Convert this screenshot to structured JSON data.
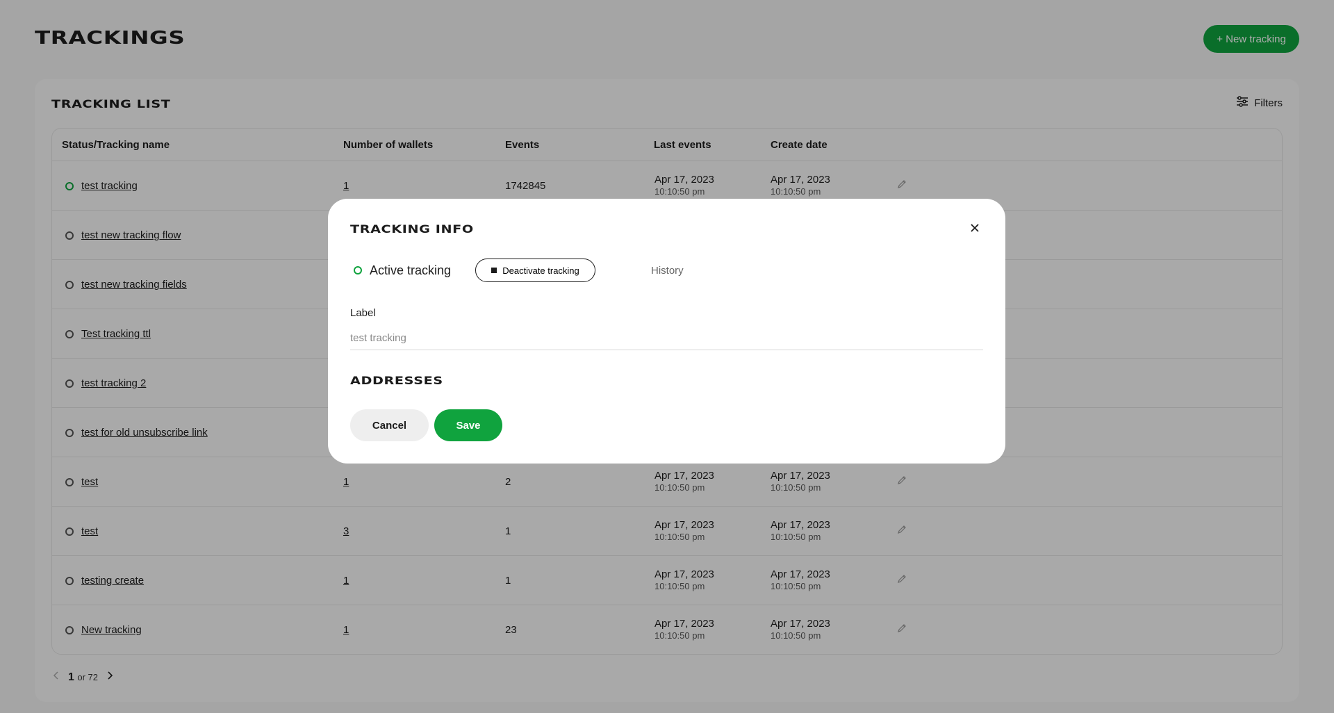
{
  "page": {
    "title": "TRACKINGS",
    "new_button": "+ New tracking"
  },
  "list": {
    "title": "TRACKING LIST",
    "filters_label": "Filters",
    "columns": [
      "Status/Tracking name",
      "Number of wallets",
      "Events",
      "Last events",
      "Create date"
    ],
    "rows": [
      {
        "name": "test tracking",
        "active": true,
        "wallets": "1",
        "events": "1742845",
        "last_date": "Apr 17, 2023",
        "last_time": "10:10:50 pm",
        "create_date": "Apr 17, 2023",
        "create_time": "10:10:50 pm"
      },
      {
        "name": "test new tracking flow",
        "active": false,
        "wallets": "",
        "events": "",
        "last_date": "",
        "last_time": "",
        "create_date": "",
        "create_time": ""
      },
      {
        "name": "test new tracking fields",
        "active": false,
        "wallets": "",
        "events": "",
        "last_date": "",
        "last_time": "",
        "create_date": "",
        "create_time": ""
      },
      {
        "name": "Test tracking ttl",
        "active": false,
        "wallets": "",
        "events": "",
        "last_date": "",
        "last_time": "",
        "create_date": "",
        "create_time": ""
      },
      {
        "name": "test tracking 2",
        "active": false,
        "wallets": "",
        "events": "",
        "last_date": "",
        "last_time": "",
        "create_date": "",
        "create_time": ""
      },
      {
        "name": "test for old unsubscribe link",
        "active": false,
        "wallets": "",
        "events": "",
        "last_date": "",
        "last_time": "",
        "create_date": "",
        "create_time": ""
      },
      {
        "name": "test",
        "active": false,
        "wallets": "1",
        "events": "2",
        "last_date": "Apr 17, 2023",
        "last_time": "10:10:50 pm",
        "create_date": "Apr 17, 2023",
        "create_time": "10:10:50 pm"
      },
      {
        "name": "test",
        "active": false,
        "wallets": "3",
        "events": "1",
        "last_date": "Apr 17, 2023",
        "last_time": "10:10:50 pm",
        "create_date": "Apr 17, 2023",
        "create_time": "10:10:50 pm"
      },
      {
        "name": "testing create",
        "active": false,
        "wallets": "1",
        "events": "1",
        "last_date": "Apr 17, 2023",
        "last_time": "10:10:50 pm",
        "create_date": "Apr 17, 2023",
        "create_time": "10:10:50 pm"
      },
      {
        "name": "New tracking",
        "active": false,
        "wallets": "1",
        "events": "23",
        "last_date": "Apr 17, 2023",
        "last_time": "10:10:50 pm",
        "create_date": "Apr 17, 2023",
        "create_time": "10:10:50 pm"
      }
    ]
  },
  "pagination": {
    "current": "1",
    "of_text": "or 72"
  },
  "modal": {
    "title": "TRACKING INFO",
    "status": "Active tracking",
    "deactivate_label": "Deactivate tracking",
    "history_label": "History",
    "label_field": {
      "label": "Label",
      "placeholder": "test tracking"
    },
    "addresses_title": "ADDRESSES",
    "cancel_label": "Cancel",
    "save_label": "Save"
  },
  "colors": {
    "accent": "#10a33e",
    "text": "#1c1c1c",
    "background": "#f3f3f3"
  },
  "icons": {
    "filters": "sliders-icon",
    "edit": "pencil-icon",
    "close": "close-icon",
    "prev": "chevron-left-icon",
    "next": "chevron-right-icon"
  }
}
